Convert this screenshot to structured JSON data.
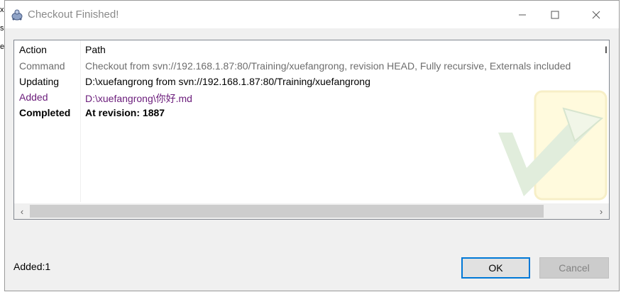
{
  "window": {
    "title": "Checkout Finished!",
    "minimize_glyph": "—",
    "maximize_glyph": "☐",
    "close_glyph": "✕"
  },
  "background_chars": [
    "x",
    "s",
    "e"
  ],
  "table": {
    "headers": {
      "action": "Action",
      "path": "Path",
      "stub": "I"
    },
    "rows": [
      {
        "action": "Command",
        "path": "Checkout from svn://192.168.1.87:80/Training/xuefangrong, revision HEAD, Fully recursive, Externals included",
        "color": "#6d6d6d",
        "bold": false
      },
      {
        "action": "Updating",
        "path": "D:\\xuefangrong from svn://192.168.1.87:80/Training/xuefangrong",
        "color": "#000000",
        "bold": false
      },
      {
        "action": "Added",
        "path": "D:\\xuefangrong\\你好.md",
        "color": "#6a1b7a",
        "bold": false
      },
      {
        "action": "Completed",
        "path": "At revision: 1887",
        "color": "#000000",
        "bold": true
      }
    ]
  },
  "scrollbar": {
    "left_arrow": "‹",
    "right_arrow": "›"
  },
  "status": {
    "text": "Added:1"
  },
  "buttons": {
    "ok": "OK",
    "cancel": "Cancel"
  },
  "colors": {
    "accent": "#0078d7",
    "command_gray": "#6d6d6d",
    "added_purple": "#6a1b7a"
  },
  "icons": {
    "app": "tortoise-icon",
    "watermark": "checkmark-watermark-icon"
  }
}
